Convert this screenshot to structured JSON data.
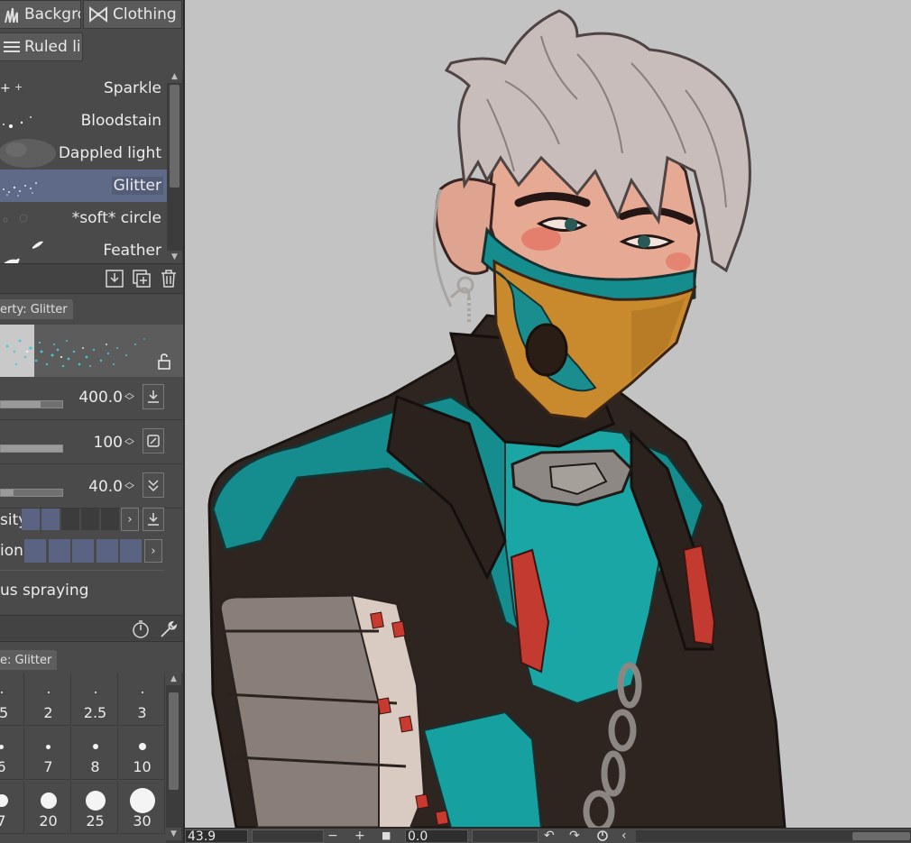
{
  "material_tabs": [
    {
      "label": "Backgro",
      "icon": "grass-icon"
    },
    {
      "label": "Clothing",
      "icon": "bow-icon"
    },
    {
      "label": "Ruled lir",
      "icon": "lines-icon"
    }
  ],
  "brush_list": {
    "items": [
      {
        "label": "Sparkle",
        "selected": false
      },
      {
        "label": "Bloodstain",
        "selected": false
      },
      {
        "label": "Dappled light",
        "selected": false
      },
      {
        "label": "Glitter",
        "selected": true
      },
      {
        "label": "*soft* circle",
        "selected": false
      },
      {
        "label": "Feather",
        "selected": false
      }
    ],
    "actions": [
      "download-icon",
      "add-copy-icon",
      "trash-icon"
    ]
  },
  "tool_property": {
    "tab_label": "erty: Glitter",
    "rows": [
      {
        "value": "400.0",
        "fill": 0.65,
        "button_icon": "download-icon"
      },
      {
        "value": "100",
        "fill": 1.0,
        "button_icon": "no-entry-icon"
      },
      {
        "value": "40.0",
        "fill": 0.2,
        "button_icon": "double-check-icon"
      }
    ],
    "density": {
      "label": "sity",
      "cells_on": 2,
      "cells_total": 5
    },
    "direction": {
      "label": "ion",
      "cells_on": 5,
      "cells_total": 5
    },
    "continuous_label": "us spraying",
    "footer_icons": [
      "dial-icon",
      "wrench-icon"
    ]
  },
  "brush_size": {
    "tab_label": "e: Glitter",
    "rows": [
      [
        ".5",
        "2",
        "2.5",
        "3"
      ],
      [
        "6",
        "7",
        "8",
        "10"
      ],
      [
        "7",
        "20",
        "25",
        "30"
      ]
    ]
  },
  "status_bar": {
    "zoom": "43.9",
    "angle": "0.0",
    "minus": "−",
    "plus": "+",
    "stop": "■",
    "rotate_left": "↶",
    "rotate_right": "↷",
    "chevron": "‹"
  },
  "colors": {
    "panel_bg": "#4a4a4a",
    "selection": "#5f6a88",
    "canvas_bg": "#c3c3c3",
    "teal": "#1a9a9a",
    "mask_orange": "#c98a2e",
    "hair": "#c9bfbd"
  }
}
